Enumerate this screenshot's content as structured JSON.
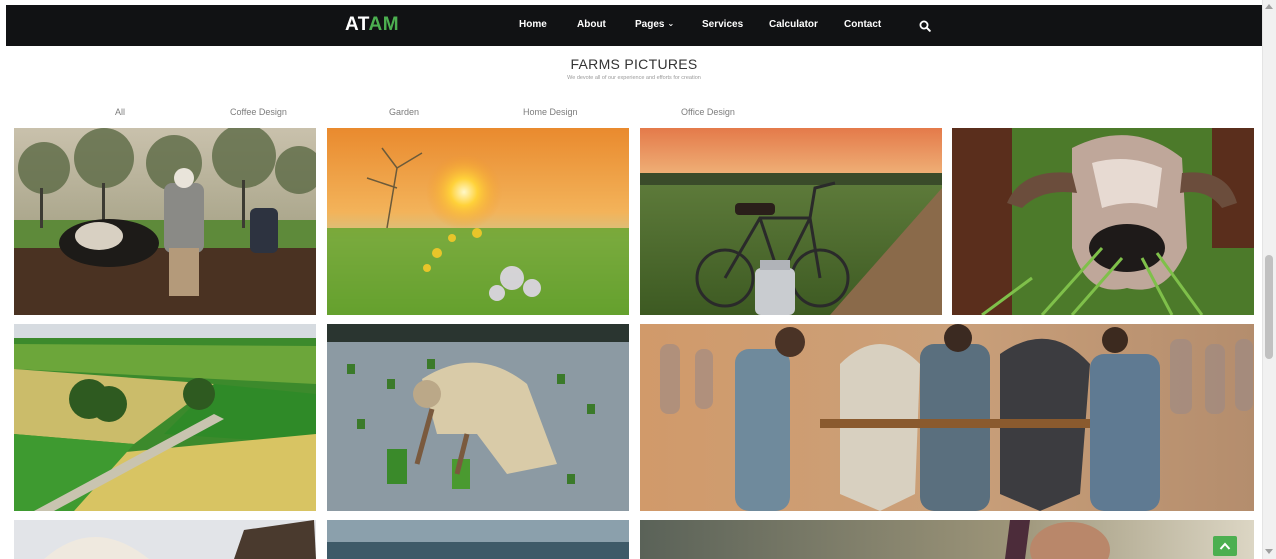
{
  "brand": {
    "logo_part1": "AT",
    "logo_part2": "AM",
    "accent_color": "#4caf50"
  },
  "nav": {
    "home": "Home",
    "about": "About",
    "pages": "Pages",
    "services": "Services",
    "calculator": "Calculator",
    "contact": "Contact"
  },
  "icons": {
    "search": "search-icon",
    "pages_caret": "chevron-down-icon",
    "back_to_top": "chevron-up-icon"
  },
  "section": {
    "title": "FARMS PICTURES",
    "subtitle": "We devote all of our experience and efforts for creation"
  },
  "filters": {
    "all": "All",
    "coffee": "Coffee Design",
    "garden": "Garden",
    "home": "Home Design",
    "office": "Office Design"
  }
}
